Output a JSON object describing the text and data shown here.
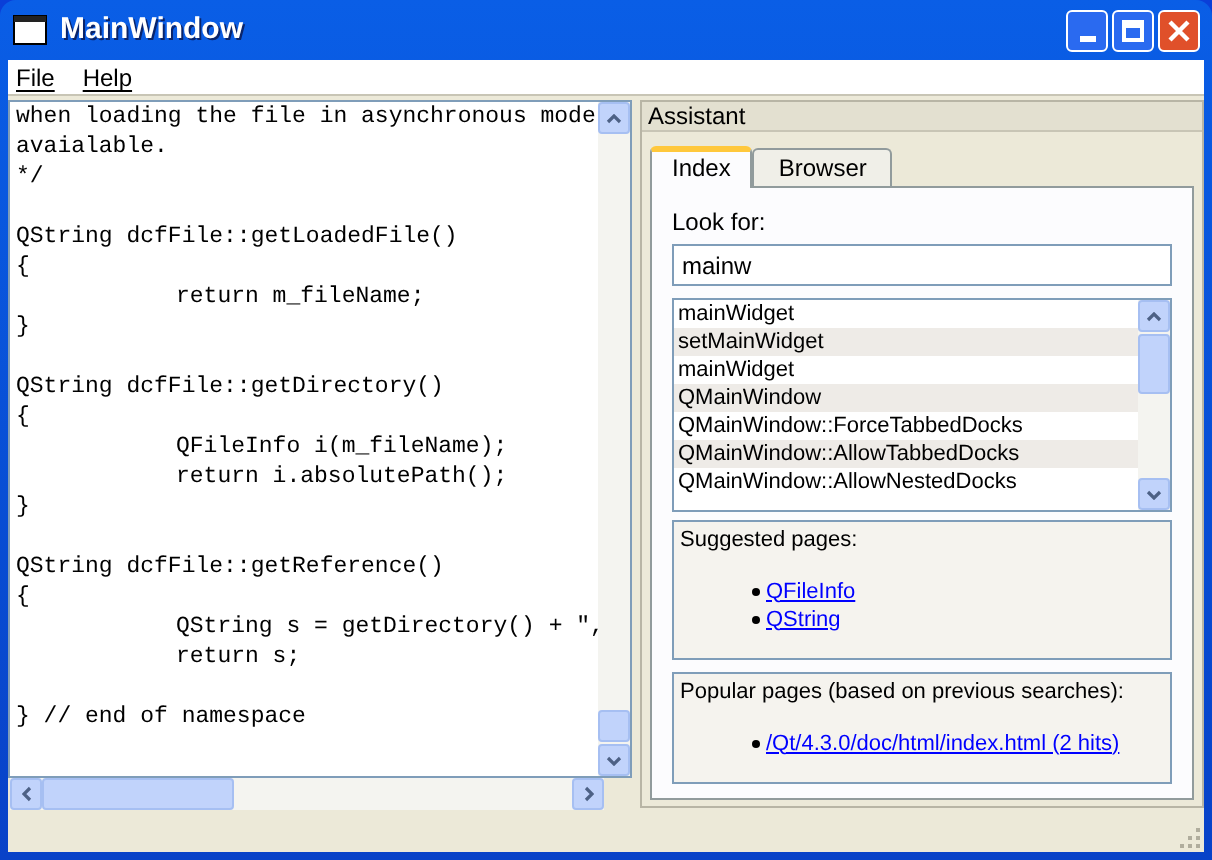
{
  "window": {
    "title": "MainWindow"
  },
  "menu": [
    {
      "label": "File"
    },
    {
      "label": "Help"
    }
  ],
  "editor": {
    "lines": [
      {
        "text": "when loading the file in asynchronous mode"
      },
      {
        "text": "avaialable."
      },
      {
        "text": "*/"
      },
      {
        "blank": true
      },
      {
        "text": "QString dcfFile::getLoadedFile()"
      },
      {
        "text": "{"
      },
      {
        "text": "\treturn m_fileName;"
      },
      {
        "text": "}"
      },
      {
        "blank": true
      },
      {
        "text": "QString dcfFile::getDirectory()"
      },
      {
        "text": "{"
      },
      {
        "text": "\tQFileInfo i(m_fileName);"
      },
      {
        "text": "\treturn i.absolutePath();"
      },
      {
        "text": "}"
      },
      {
        "blank": true
      },
      {
        "text": "QString dcfFile::getReference()"
      },
      {
        "text": "{"
      },
      {
        "text": "\tQString s = getDirectory() + \","
      },
      {
        "text": "\treturn s;"
      },
      {
        "blank": true
      },
      {
        "text": "} // end of namespace"
      }
    ]
  },
  "assistant": {
    "title": "Assistant",
    "tabs": [
      {
        "label": "Index",
        "selected": true
      },
      {
        "label": "Browser",
        "selected": false
      }
    ],
    "look_for_label": "Look for:",
    "search": {
      "value": "mainw"
    },
    "results": [
      "mainWidget",
      "setMainWidget",
      "mainWidget",
      "QMainWindow",
      "QMainWindow::ForceTabbedDocks",
      "QMainWindow::AllowTabbedDocks",
      "QMainWindow::AllowNestedDocks"
    ],
    "suggested": {
      "heading": "Suggested pages:",
      "links": [
        "QFileInfo",
        "QString"
      ]
    },
    "popular": {
      "heading": "Popular pages (based on previous searches):",
      "links": [
        "/Qt/4.3.0/doc/html/index.html (2 hits)"
      ]
    }
  }
}
